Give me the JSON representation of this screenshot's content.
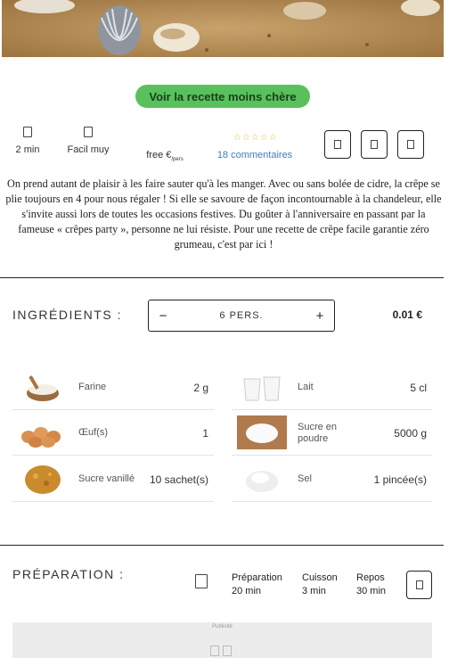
{
  "cta_label": "Voir la recette moins chère",
  "meta": {
    "time": "2 min",
    "difficulty": "Facil muy",
    "cost": "free €",
    "cost_suffix": "/pers",
    "rating_stars": "☆☆☆☆☆",
    "comments": "18 commentaires"
  },
  "intro": "On prend autant de plaisir à les faire sauter qu'à les manger. Avec ou sans bolée de cidre, la crêpe se plie toujours en 4 pour nous régaler ! Si elle se savoure de façon incontournable à la chandeleur, elle s'invite aussi lors de toutes les occasions festives. Du goûter à l'anniversaire en passant par la fameuse « crêpes party », personne ne lui résiste. Pour une recette de crêpe facile garantie zéro grumeau, c'est par ici !",
  "ingredients": {
    "title": "INGRÉDIENTS :",
    "minus": "−",
    "plus": "+",
    "servings": "6 PERS.",
    "price": "0.01 €",
    "items": [
      {
        "name": "Farine",
        "qty": "2 g"
      },
      {
        "name": "Lait",
        "qty": "5 cl"
      },
      {
        "name": "Œuf(s)",
        "qty": "1"
      },
      {
        "name": "Sucre en poudre",
        "qty": "5000 g"
      },
      {
        "name": "Sucre vanillé",
        "qty": "10 sachet(s)"
      },
      {
        "name": "Sel",
        "qty": "1 pincée(s)"
      }
    ]
  },
  "preparation": {
    "title": "PRÉPARATION :",
    "prep_label": "Préparation",
    "prep_value": "20 min",
    "cook_label": "Cuisson",
    "cook_value": "3 min",
    "rest_label": "Repos",
    "rest_value": "30 min"
  },
  "ad_label": "Publicité",
  "colors": {
    "cta": "#59c15c",
    "link": "#3b7dc4",
    "stars": "#e0b84a"
  }
}
